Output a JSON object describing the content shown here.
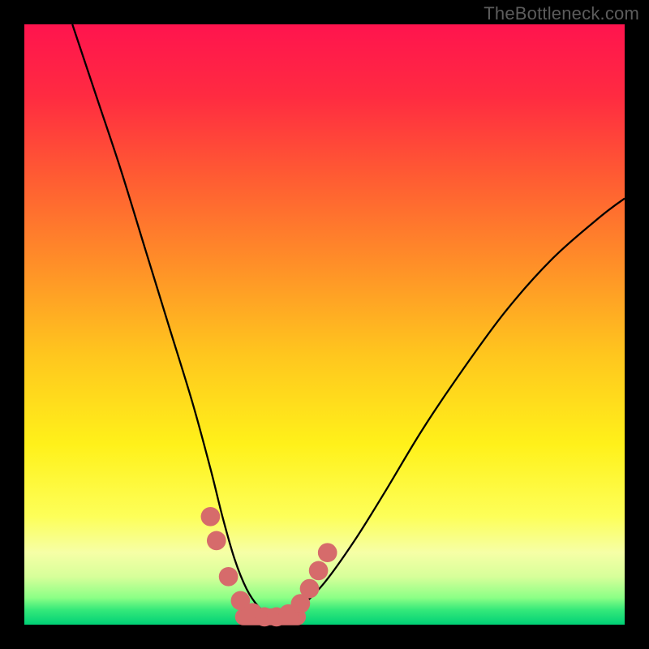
{
  "watermark": "TheBottleneck.com",
  "gradient": {
    "stops": [
      {
        "offset": 0.0,
        "color": "#ff144e"
      },
      {
        "offset": 0.12,
        "color": "#ff2b41"
      },
      {
        "offset": 0.25,
        "color": "#ff5a33"
      },
      {
        "offset": 0.4,
        "color": "#ff8f28"
      },
      {
        "offset": 0.55,
        "color": "#ffc61e"
      },
      {
        "offset": 0.7,
        "color": "#fff11a"
      },
      {
        "offset": 0.82,
        "color": "#fdff59"
      },
      {
        "offset": 0.88,
        "color": "#f6ffa6"
      },
      {
        "offset": 0.92,
        "color": "#d7ff9a"
      },
      {
        "offset": 0.955,
        "color": "#8cff86"
      },
      {
        "offset": 0.975,
        "color": "#36e97a"
      },
      {
        "offset": 1.0,
        "color": "#00d176"
      }
    ]
  },
  "chart_data": {
    "type": "line",
    "title": "",
    "xlabel": "",
    "ylabel": "",
    "xlim": [
      0,
      100
    ],
    "ylim": [
      0,
      100
    ],
    "grid": false,
    "series": [
      {
        "name": "bottleneck-curve",
        "x": [
          8,
          12,
          16,
          20,
          24,
          28,
          31,
          33,
          35,
          37,
          39,
          41,
          43,
          46,
          50,
          55,
          60,
          66,
          72,
          80,
          88,
          96,
          100
        ],
        "y": [
          100,
          88,
          76,
          63,
          50,
          37,
          26,
          18,
          11,
          6,
          3,
          1.5,
          1.5,
          3,
          7,
          14,
          22,
          32,
          41,
          52,
          61,
          68,
          71
        ]
      }
    ],
    "markers": {
      "name": "highlight-points",
      "color": "#d66b6b",
      "points": [
        {
          "x": 31,
          "y": 18,
          "r": 1.6
        },
        {
          "x": 32,
          "y": 14,
          "r": 1.6
        },
        {
          "x": 34,
          "y": 8,
          "r": 1.6
        },
        {
          "x": 36,
          "y": 4,
          "r": 1.6
        },
        {
          "x": 38,
          "y": 2,
          "r": 1.6
        },
        {
          "x": 40,
          "y": 1.3,
          "r": 1.6
        },
        {
          "x": 42,
          "y": 1.3,
          "r": 1.6
        },
        {
          "x": 44,
          "y": 1.8,
          "r": 1.6
        },
        {
          "x": 46,
          "y": 3.5,
          "r": 1.6
        },
        {
          "x": 47.5,
          "y": 6,
          "r": 1.6
        },
        {
          "x": 49,
          "y": 9,
          "r": 1.6
        },
        {
          "x": 50.5,
          "y": 12,
          "r": 1.6
        }
      ],
      "bar": {
        "x1": 36.5,
        "x2": 45.5,
        "y": 1.3,
        "thickness": 2.8
      }
    }
  }
}
